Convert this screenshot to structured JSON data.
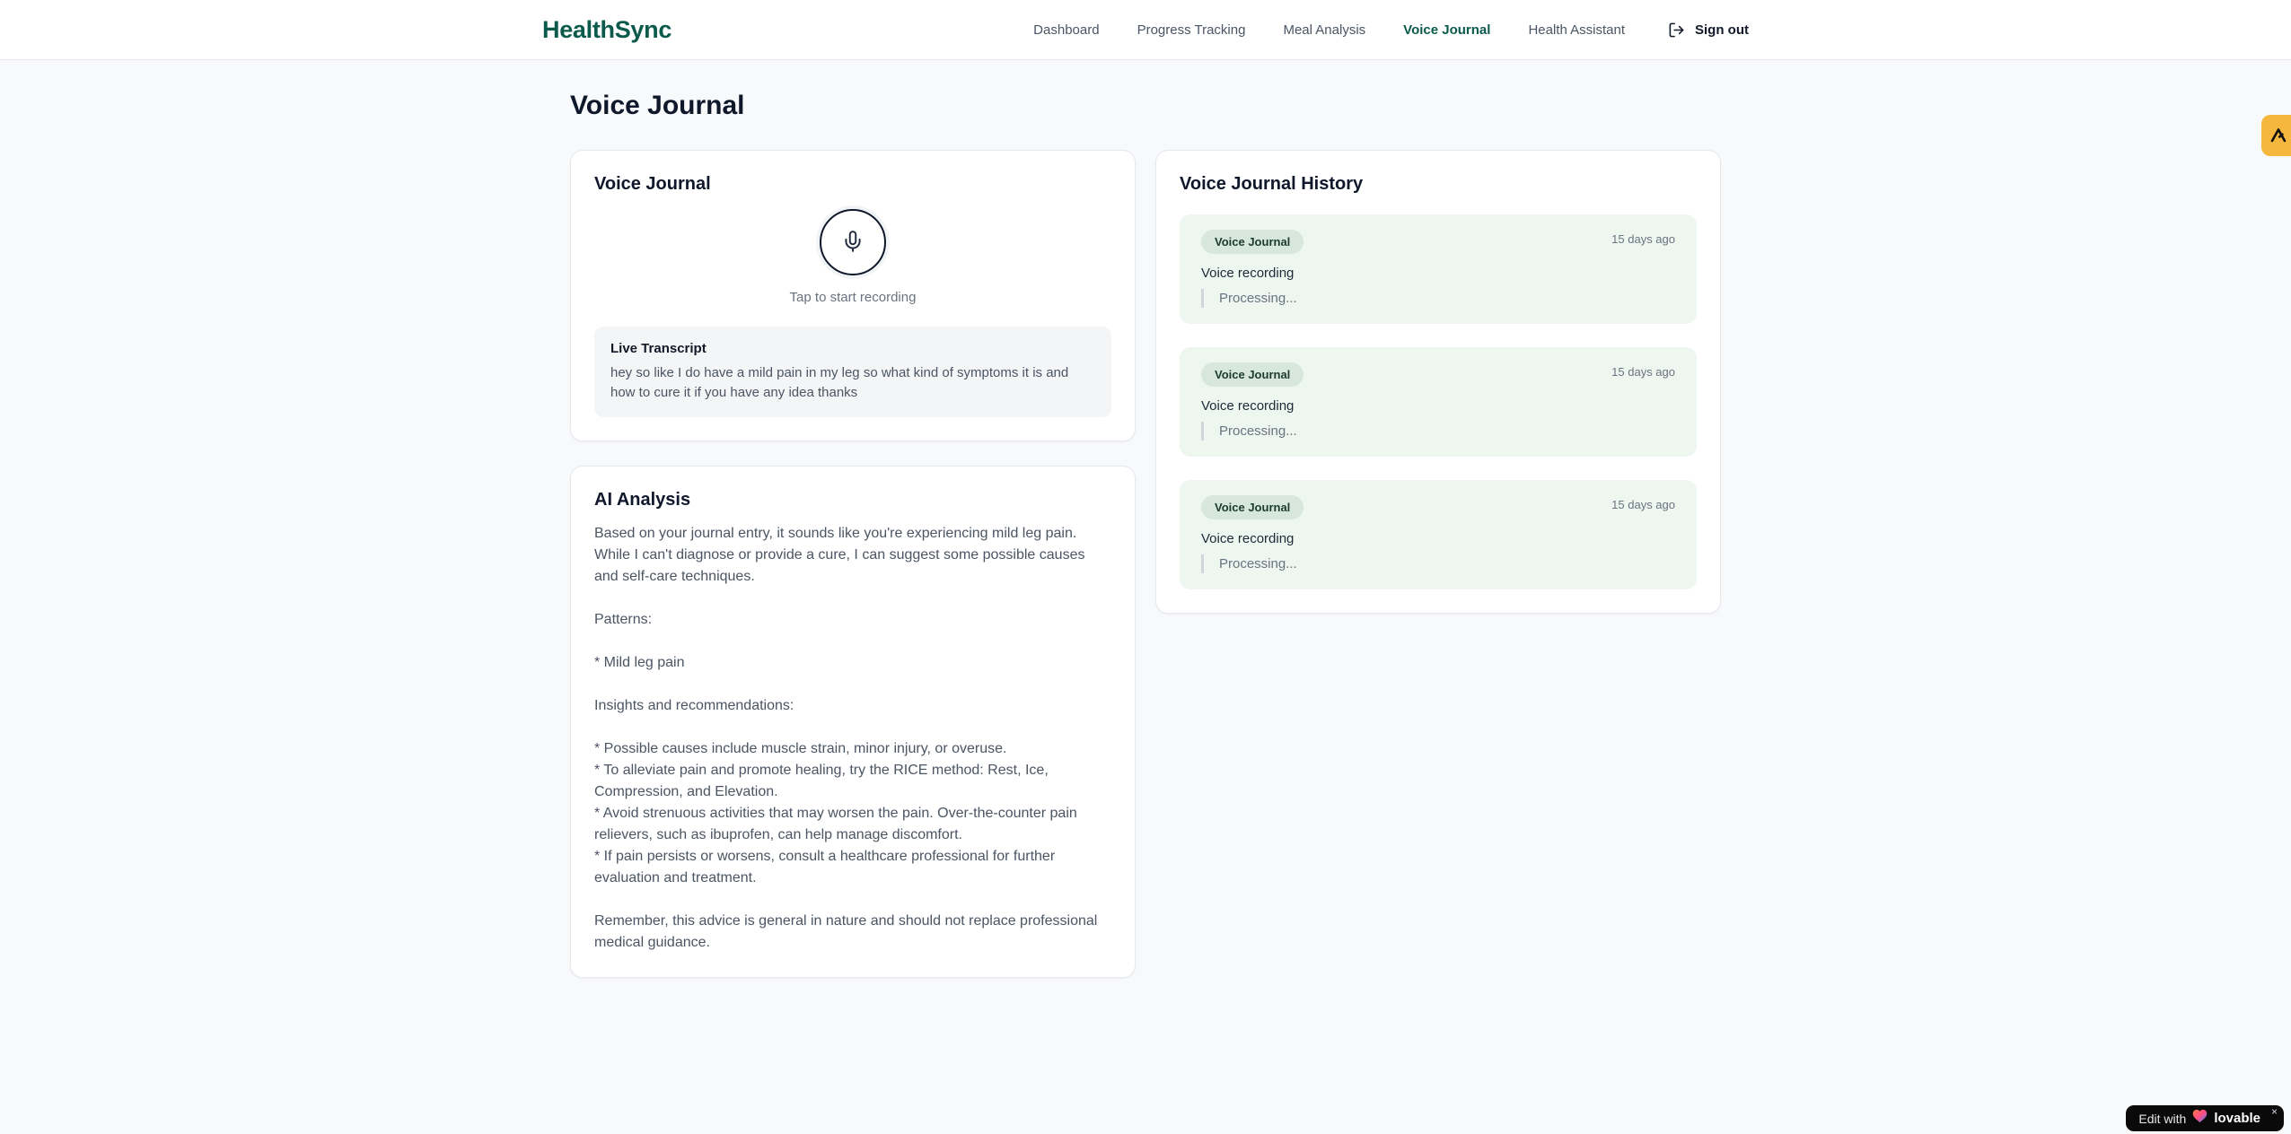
{
  "brand": {
    "name": "HealthSync"
  },
  "nav": {
    "items": [
      {
        "label": "Dashboard",
        "active": false
      },
      {
        "label": "Progress Tracking",
        "active": false
      },
      {
        "label": "Meal Analysis",
        "active": false
      },
      {
        "label": "Voice Journal",
        "active": true
      },
      {
        "label": "Health Assistant",
        "active": false
      }
    ],
    "sign_out_label": "Sign out"
  },
  "page": {
    "title": "Voice Journal"
  },
  "recorder_card": {
    "title": "Voice Journal",
    "tap_hint": "Tap to start recording",
    "mic_icon": "microphone-icon",
    "transcript_title": "Live Transcript",
    "transcript_text": "hey so like I do have a mild pain in my leg so what kind of symptoms it is and how to cure it if you have any idea thanks"
  },
  "analysis_card": {
    "title": "AI Analysis",
    "body": "Based on your journal entry, it sounds like you're experiencing mild leg pain. While I can't diagnose or provide a cure, I can suggest some possible causes and self-care techniques.\n\nPatterns:\n\n* Mild leg pain\n\nInsights and recommendations:\n\n* Possible causes include muscle strain, minor injury, or overuse.\n* To alleviate pain and promote healing, try the RICE method: Rest, Ice, Compression, and Elevation.\n* Avoid strenuous activities that may worsen the pain. Over-the-counter pain relievers, such as ibuprofen, can help manage discomfort.\n* If pain persists or worsens, consult a healthcare professional for further evaluation and treatment.\n\nRemember, this advice is general in nature and should not replace professional medical guidance."
  },
  "history_card": {
    "title": "Voice Journal History",
    "entries": [
      {
        "badge": "Voice Journal",
        "time": "15 days ago",
        "label": "Voice recording",
        "status": "Processing..."
      },
      {
        "badge": "Voice Journal",
        "time": "15 days ago",
        "label": "Voice recording",
        "status": "Processing..."
      },
      {
        "badge": "Voice Journal",
        "time": "15 days ago",
        "label": "Voice recording",
        "status": "Processing..."
      }
    ]
  },
  "side_tab": {
    "icon": "amber-logo-tab",
    "color": "#f5b73e"
  },
  "lovable_badge": {
    "prefix": "Edit with",
    "heart_icon": "heart-gradient-icon",
    "brand": "lovable",
    "close": "×"
  },
  "colors": {
    "accent_teal": "#0b5a4c",
    "page_bg": "#f8f9fb",
    "card_border": "#e7e9ee",
    "entry_bg": "#eef6f0",
    "badge_bg": "#d7e7db",
    "badge_text": "#1d3b30",
    "muted_text": "#6b7280",
    "amber": "#f5b73e"
  }
}
